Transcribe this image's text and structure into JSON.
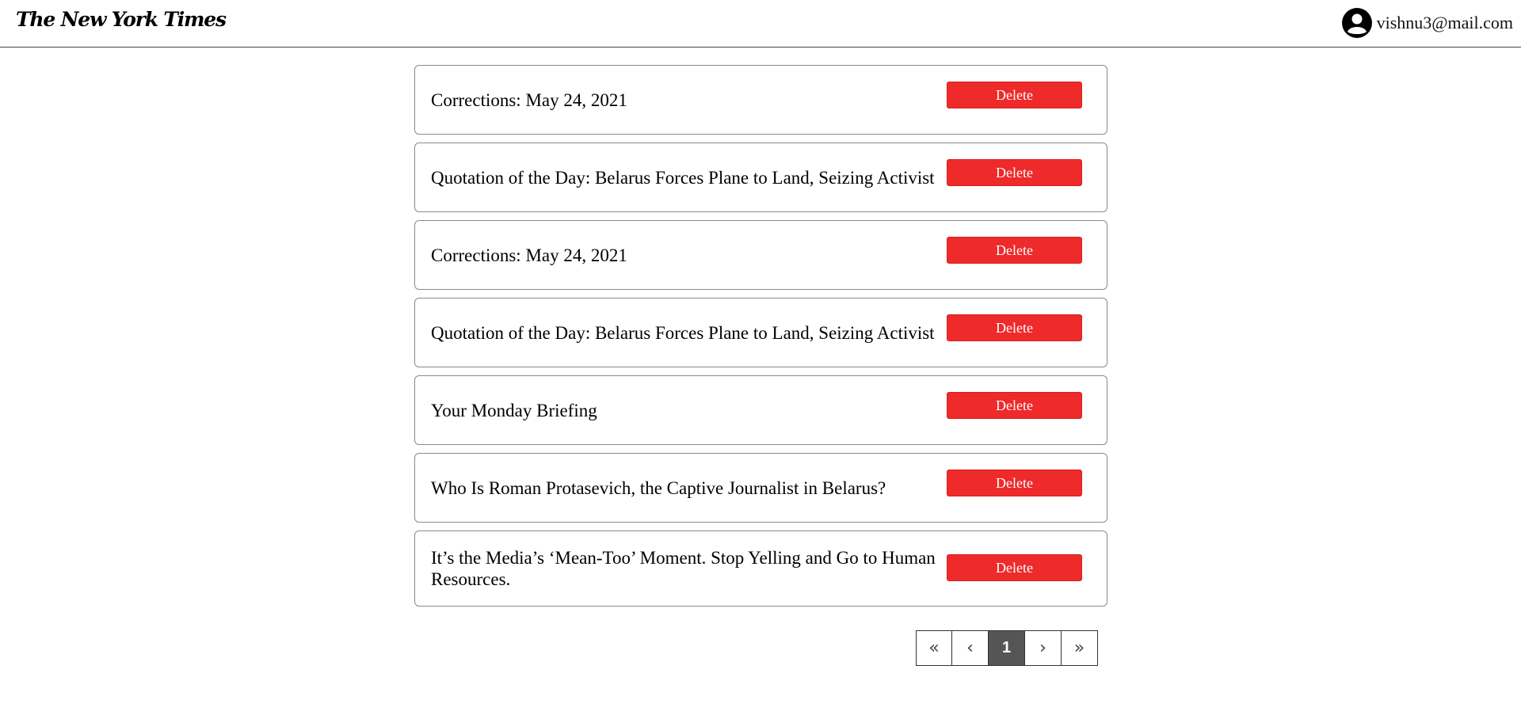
{
  "header": {
    "logo_text": "The New York Times",
    "user_email": "vishnu3@mail.com",
    "avatar_icon": "user-circle-icon"
  },
  "articles": [
    {
      "title": "Corrections: May 24, 2021",
      "delete_label": "Delete"
    },
    {
      "title": "Quotation of the Day: Belarus Forces Plane to Land, Seizing Activist",
      "delete_label": "Delete"
    },
    {
      "title": "Corrections: May 24, 2021",
      "delete_label": "Delete"
    },
    {
      "title": "Quotation of the Day: Belarus Forces Plane to Land, Seizing Activist",
      "delete_label": "Delete"
    },
    {
      "title": "Your Monday Briefing",
      "delete_label": "Delete"
    },
    {
      "title": "Who Is Roman Protasevich, the Captive Journalist in Belarus?",
      "delete_label": "Delete"
    },
    {
      "title": "It’s the Media’s ‘Mean-Too’ Moment. Stop Yelling and Go to Human Resources.",
      "delete_label": "Delete"
    }
  ],
  "pagination": {
    "first": "«",
    "prev": "‹",
    "current_page": "1",
    "next": "›",
    "last": "»"
  },
  "colors": {
    "delete_button": "#ee2a2a",
    "active_page": "#555555"
  }
}
